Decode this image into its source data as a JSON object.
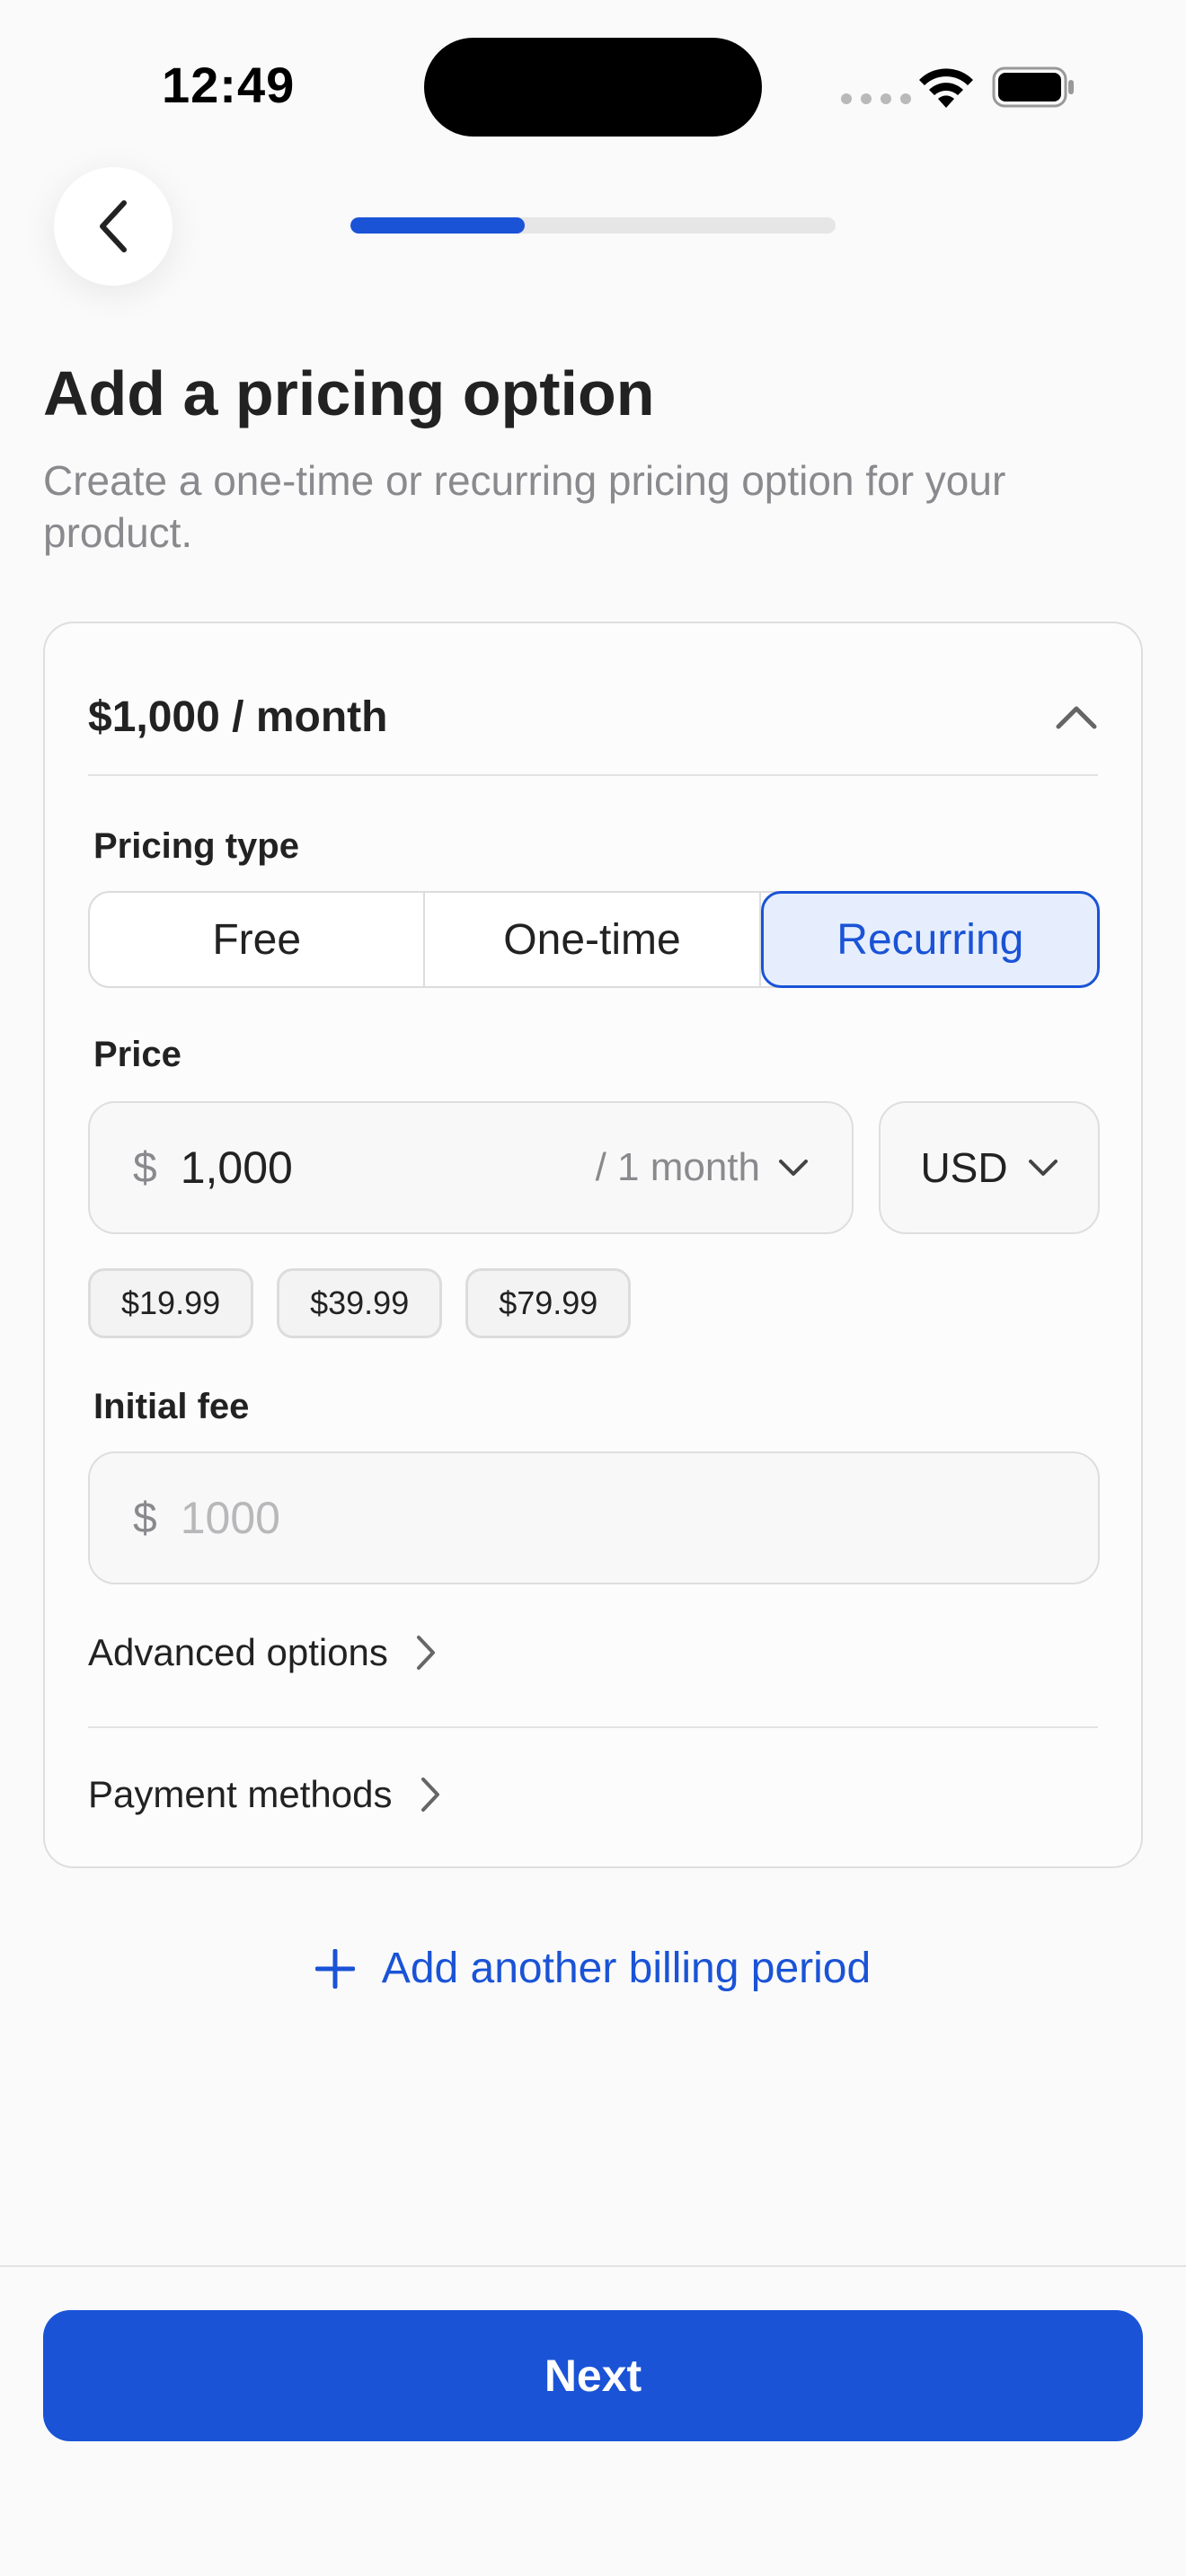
{
  "status_bar": {
    "time": "12:49"
  },
  "header": {
    "progress_fraction": 0.36
  },
  "page": {
    "title": "Add a pricing option",
    "subtitle": "Create a one-time or recurring pricing option for your product."
  },
  "card": {
    "title": "$1,000 / month",
    "pricing_type": {
      "label": "Pricing type",
      "options": [
        "Free",
        "One-time",
        "Recurring"
      ],
      "selected": "Recurring"
    },
    "price": {
      "label": "Price",
      "currency_symbol": "$",
      "value": "1,000",
      "period": "/ 1 month",
      "currency": "USD",
      "suggestions": [
        "$19.99",
        "$39.99",
        "$79.99"
      ]
    },
    "initial_fee": {
      "label": "Initial fee",
      "currency_symbol": "$",
      "placeholder": "1000"
    },
    "advanced_options_label": "Advanced options",
    "payment_methods_label": "Payment methods"
  },
  "add_period_label": "Add another billing period",
  "next_label": "Next",
  "colors": {
    "accent": "#1a53d6",
    "accent_bg": "#e6eefd"
  }
}
